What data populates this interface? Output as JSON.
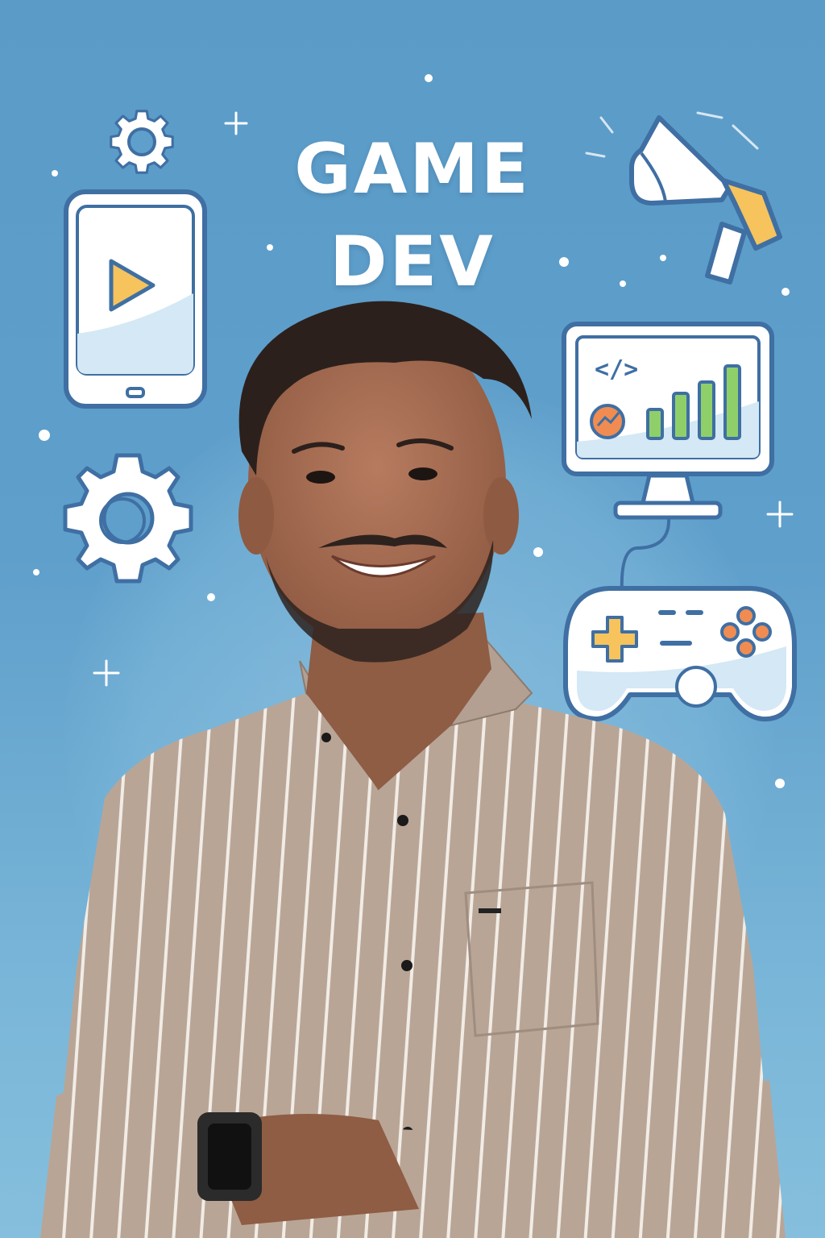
{
  "title": {
    "line1": "GAME",
    "line2": "DEV"
  },
  "icons": [
    "gear-icon",
    "smartphone-play-icon",
    "megaphone-icon",
    "monitor-code-chart-icon",
    "gamepad-icon",
    "sparkle-icon"
  ],
  "colors": {
    "background": "#5f9fcb",
    "icon_stroke": "#3f6fa3",
    "icon_fill": "#ffffff",
    "accent_orange": "#f2a93b",
    "accent_green": "#8fcf6a",
    "shirt": "#b9a596"
  },
  "monitor_code_symbol": "</>"
}
